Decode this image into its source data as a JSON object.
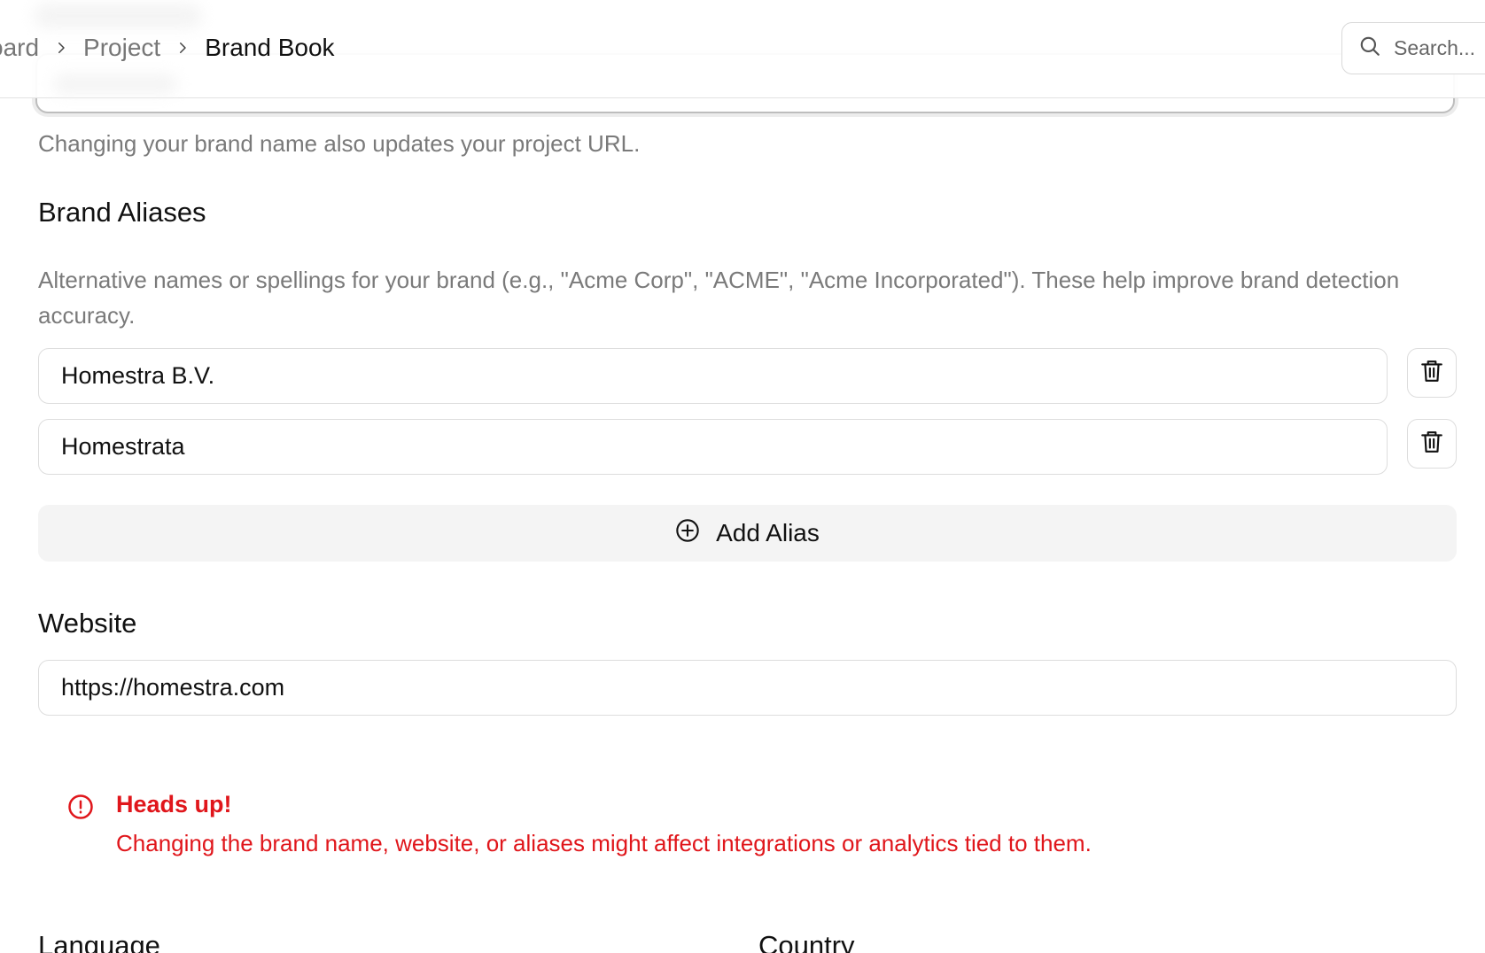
{
  "breadcrumb": {
    "items": [
      "oard",
      "Project",
      "Brand Book"
    ]
  },
  "search": {
    "placeholder": "Search..."
  },
  "brand_name": {
    "helper": "Changing your brand name also updates your project URL."
  },
  "aliases": {
    "title": "Brand Aliases",
    "description": "Alternative names or spellings for your brand (e.g., \"Acme Corp\", \"ACME\", \"Acme Incorporated\"). These help improve brand detection accuracy.",
    "items": [
      "Homestra B.V.",
      "Homestrata"
    ],
    "add_label": "Add Alias"
  },
  "website": {
    "title": "Website",
    "value": "https://homestra.com"
  },
  "alert": {
    "title": "Heads up!",
    "text": "Changing the brand name, website, or aliases might affect integrations or analytics tied to them.",
    "color": "#e0161b"
  },
  "bottom": {
    "language_label": "Language",
    "country_label": "Country"
  },
  "icons": {
    "chevron": "chevron-right-icon",
    "search": "search-icon",
    "delete": "trash-icon",
    "add": "plus-circle-icon",
    "alert": "alert-circle-icon"
  }
}
